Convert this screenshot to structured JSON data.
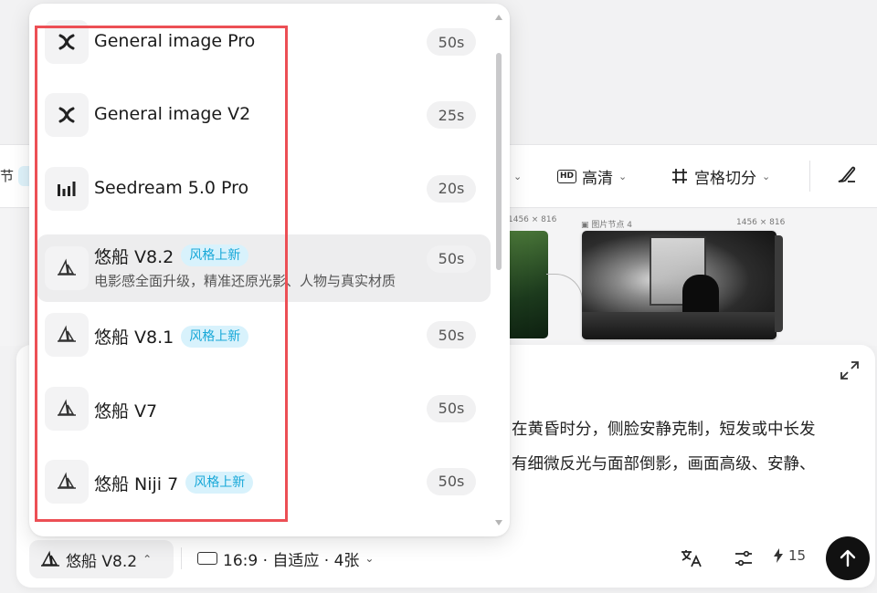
{
  "toolbar": {
    "edge_text": "节",
    "quality_label": "高清",
    "quality_badge": "HD",
    "grid_label": "宫格切分",
    "icons": [
      "hd-icon",
      "grid-icon",
      "brush-icon",
      "chevron-down-icon"
    ]
  },
  "canvas": {
    "node_left_size": "1456 × 816",
    "node_label": "图片节点 4",
    "node_size": "1456 × 816"
  },
  "prompt": {
    "line1": "在黄昏时分，侧脸安静克制，短发或中长发",
    "line2": "有细微反光与面部倒影，画面高级、安静、"
  },
  "bottom_bar": {
    "model_label": "悠船 V8.2",
    "ratio_label": "16:9 · 自适应 · 4张",
    "credits": "15"
  },
  "dropdown": {
    "items": [
      {
        "name": "General image Pro",
        "time": "50s",
        "icon": "x-cross-icon",
        "tag": "",
        "desc": ""
      },
      {
        "name": "General image V2",
        "time": "25s",
        "icon": "x-cross-icon",
        "tag": "",
        "desc": ""
      },
      {
        "name": "Seedream 5.0 Pro",
        "time": "20s",
        "icon": "bars-icon",
        "tag": "",
        "desc": ""
      },
      {
        "name": "悠船 V8.2",
        "time": "50s",
        "icon": "sailboat-icon",
        "tag": "风格上新",
        "desc": "电影感全面升级，精准还原光影、人物与真实材质"
      },
      {
        "name": "悠船 V8.1",
        "time": "50s",
        "icon": "sailboat-icon",
        "tag": "风格上新",
        "desc": ""
      },
      {
        "name": "悠船 V7",
        "time": "50s",
        "icon": "sailboat-icon",
        "tag": "",
        "desc": ""
      },
      {
        "name": "悠船 Niji 7",
        "time": "50s",
        "icon": "sailboat-icon",
        "tag": "风格上新",
        "desc": ""
      }
    ],
    "selected_index": 3
  },
  "colors": {
    "tag_text": "#18a8d8",
    "tag_bg": "#d8f2fc",
    "highlight_border": "#ec4f55",
    "send_button": "#111111"
  }
}
